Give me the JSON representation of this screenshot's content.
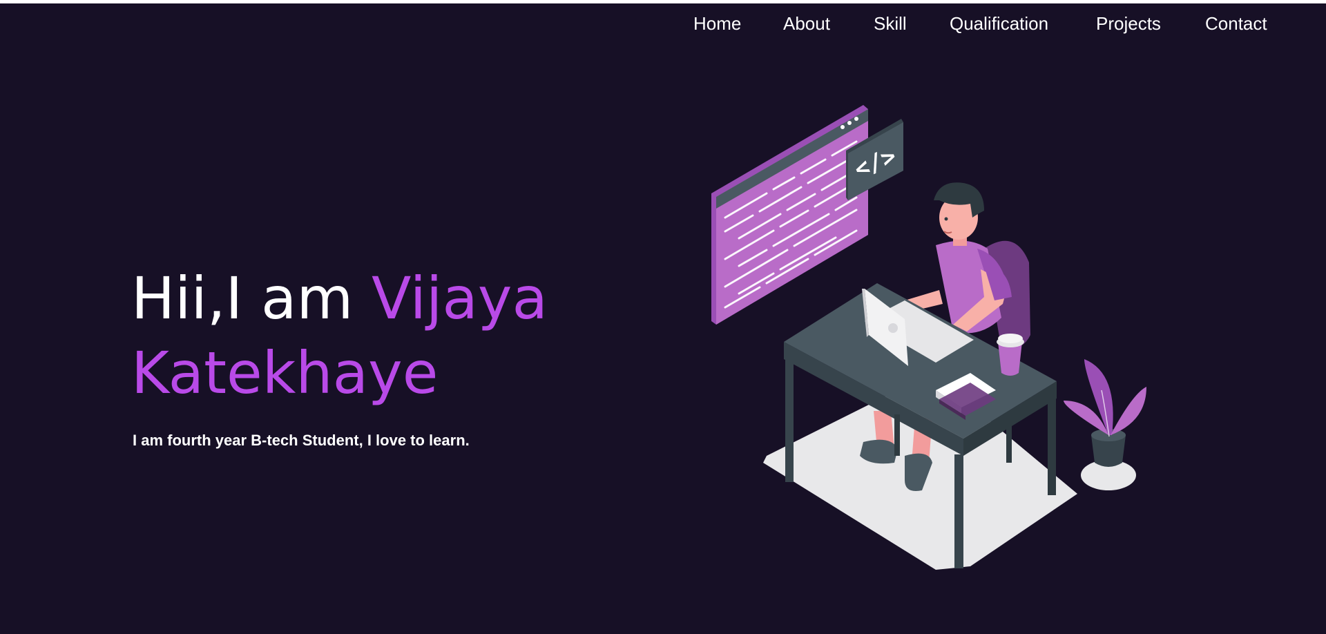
{
  "nav": {
    "items": [
      {
        "label": "Home"
      },
      {
        "label": "About"
      },
      {
        "label": "Skill"
      },
      {
        "label": "Qualification"
      },
      {
        "label": "Projects"
      },
      {
        "label": "Contact"
      }
    ]
  },
  "hero": {
    "greeting": "Hii,I am ",
    "name_first": "Vijaya",
    "name_last": "Katekhaye",
    "subtitle": "I am fourth year B-tech Student, I love to learn.",
    "code_badge": "</>"
  },
  "colors": {
    "background": "#171026",
    "accent": "#b94ae8",
    "text": "#ffffff"
  }
}
